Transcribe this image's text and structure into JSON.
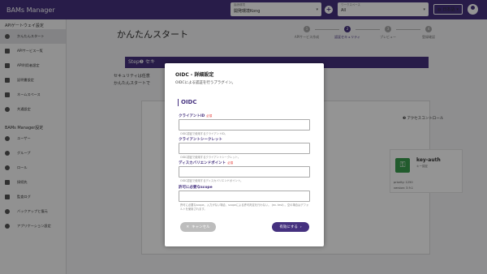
{
  "app": {
    "title": "BAMs Manager"
  },
  "header": {
    "env_caption": "接続環境",
    "env_value": "開発環境Kong",
    "plus": "+",
    "ws_caption": "ワークスペース",
    "ws_value": "All",
    "lang": "日本語",
    "arrow": "▾"
  },
  "sidebar": {
    "section1": "APIゲートウェイ設定",
    "items1": [
      {
        "label": "かんたんスタート",
        "icon": "rocket-icon"
      },
      {
        "label": "APIサービス一覧",
        "icon": "list-icon"
      },
      {
        "label": "API利用者設定",
        "icon": "api-user-icon"
      },
      {
        "label": "証明書設定",
        "icon": "certificate-icon"
      },
      {
        "label": "ネームスペース",
        "icon": "namespace-icon"
      },
      {
        "label": "共通設定",
        "icon": "gear-icon"
      }
    ],
    "section2": "BAMs Manager設定",
    "items2": [
      {
        "label": "ユーザー",
        "icon": "user-icon"
      },
      {
        "label": "グループ",
        "icon": "group-icon"
      },
      {
        "label": "ロール",
        "icon": "role-icon"
      },
      {
        "label": "接続先",
        "icon": "connection-icon"
      },
      {
        "label": "監査ログ",
        "icon": "audit-log-icon"
      },
      {
        "label": "バックアップと復元",
        "icon": "backup-icon"
      },
      {
        "label": "アプリケーション設定",
        "icon": "app-settings-icon"
      }
    ]
  },
  "main": {
    "title": "かんたんスタート",
    "steps": [
      {
        "num": "1",
        "label": "APIサービス作成",
        "active": false
      },
      {
        "num": "2",
        "label": "認証セキュリティ",
        "active": true
      },
      {
        "num": "3",
        "label": "プレビュー",
        "active": false
      },
      {
        "num": "4",
        "label": "登録確認",
        "active": false
      }
    ],
    "banner": "Step❷ セキ",
    "intro_line1": "セキュリティは任意",
    "intro_line2": "かんたんスタートで",
    "access_control": "❸ アクセスコントロール",
    "bracket_text": "| と",
    "plugin": {
      "name": "key-auth",
      "sub": "キー認証",
      "priority": "priority: 1250",
      "version": "version: 3.9.1"
    }
  },
  "modal": {
    "title": "OIDC - 詳細設定",
    "desc": "OIDCによる認証を行うプラグイン。",
    "section": "OIDC",
    "required": "必須",
    "fields": [
      {
        "label": "クライアントID",
        "required": true,
        "hint": "OIDC認証で使用するクライアントID。"
      },
      {
        "label": "クライアントシークレット",
        "required": false,
        "hint": "OIDC認証で使用するクライアントシークレット。"
      },
      {
        "label": "ディスカバリエンドポイント",
        "required": true,
        "hint": "OIDC認証で使用するディスカバリエンドポイント。"
      },
      {
        "label": "許可に必要なscope",
        "required": false,
        "hint": "許可に必要なscope。入力がない場合、scopeによる許可判定を行わない。 (ex. test) 。空の場合はデフォルトを使用されます。"
      }
    ],
    "cancel": "キャンセル",
    "enable": "有効にする",
    "cancel_icon": "✕",
    "enable_icon": "›"
  }
}
